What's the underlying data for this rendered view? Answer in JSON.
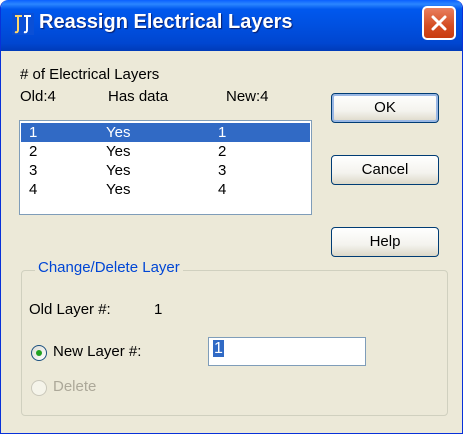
{
  "window": {
    "title": "Reassign Electrical Layers"
  },
  "header": {
    "count_label": "# of Electrical Layers",
    "old_label": "Old:4",
    "has_data_label": "Has data",
    "new_label": "New:4"
  },
  "layers": {
    "rows": [
      {
        "old": "1",
        "has_data": "Yes",
        "new": "1",
        "selected": true
      },
      {
        "old": "2",
        "has_data": "Yes",
        "new": "2",
        "selected": false
      },
      {
        "old": "3",
        "has_data": "Yes",
        "new": "3",
        "selected": false
      },
      {
        "old": "4",
        "has_data": "Yes",
        "new": "4",
        "selected": false
      }
    ]
  },
  "buttons": {
    "ok": "OK",
    "cancel": "Cancel",
    "help": "Help"
  },
  "change_group": {
    "legend": "Change/Delete Layer",
    "old_layer_label": "Old Layer #:",
    "old_layer_value": "1",
    "new_layer_label": "New Layer #:",
    "new_layer_value": "1",
    "delete_label": "Delete"
  },
  "colors": {
    "title_bar": "#0054e3",
    "selection": "#316ac5",
    "group_legend": "#0046d5",
    "dialog_bg": "#ece9d8"
  }
}
